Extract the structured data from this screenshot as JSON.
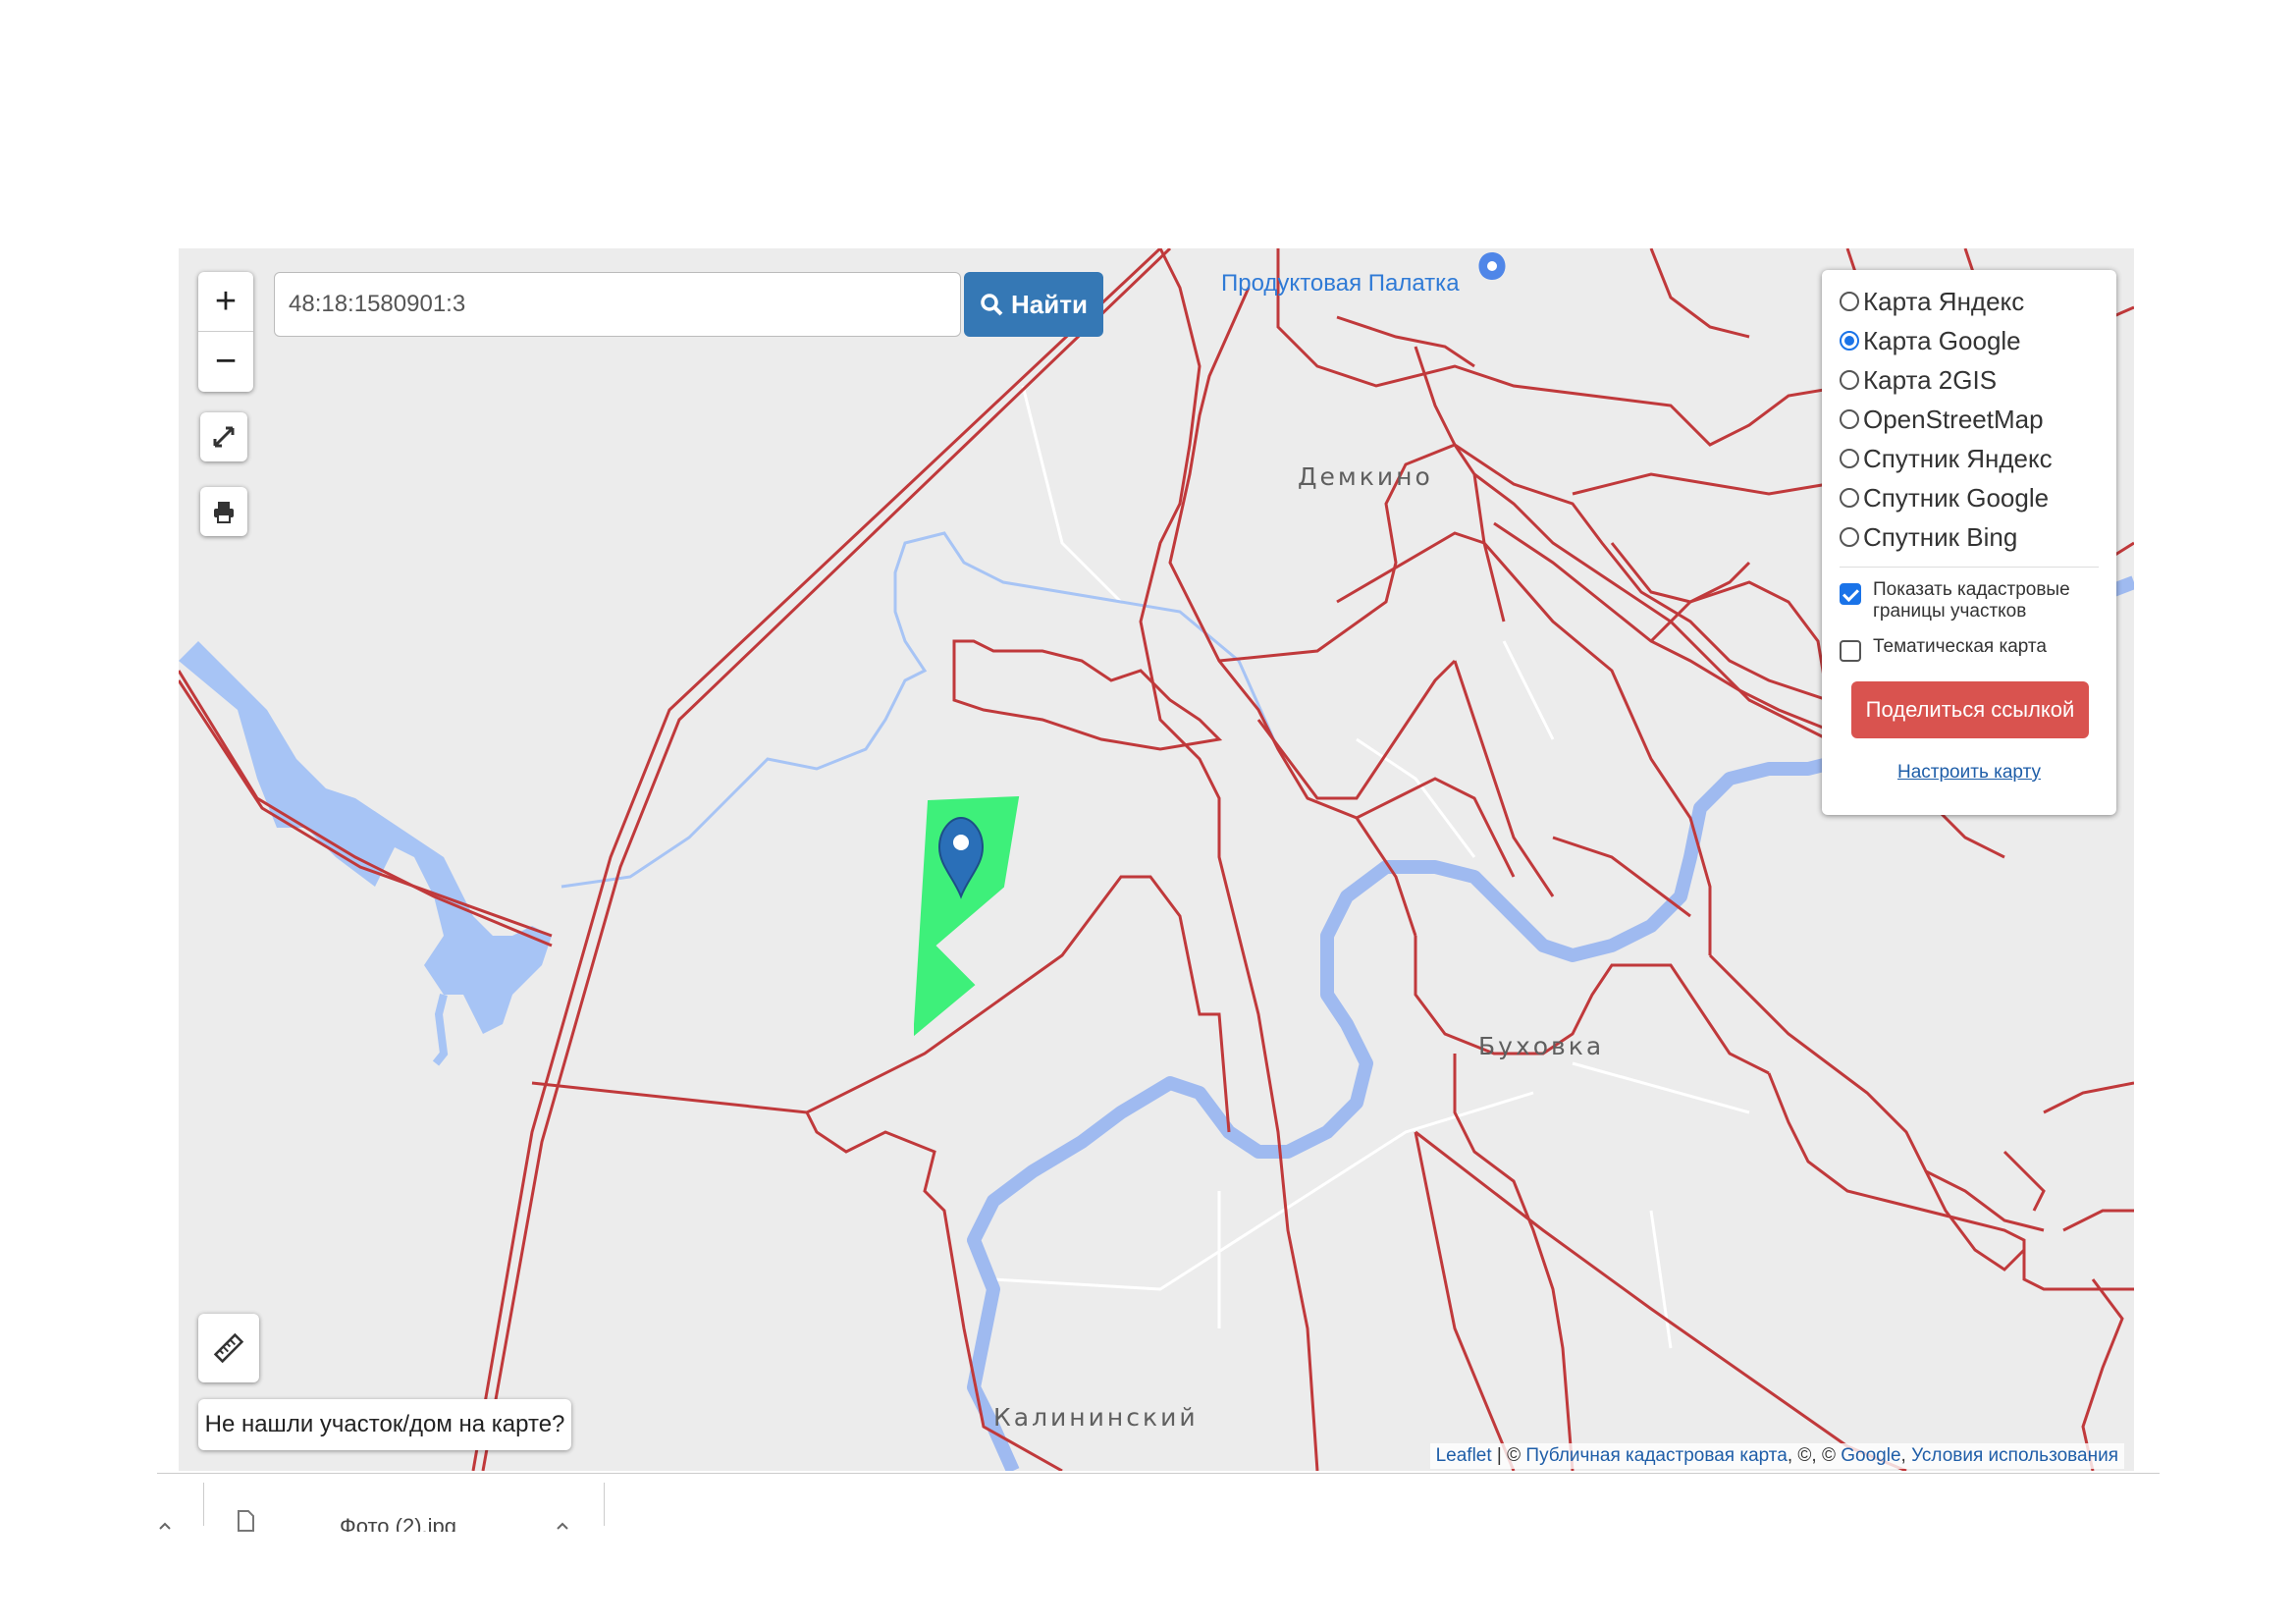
{
  "search": {
    "value": "48:18:1580901:3",
    "button_label": "Найти"
  },
  "zoom": {
    "in_label": "+",
    "out_label": "−"
  },
  "map_labels": {
    "poi": "Продуктовая Палатка",
    "village1": "Демкино",
    "village2": "Буховка",
    "village3": "Калининский"
  },
  "layers": {
    "options": [
      {
        "label": "Карта Яндекс",
        "selected": false
      },
      {
        "label": "Карта Google",
        "selected": true
      },
      {
        "label": "Карта 2GIS",
        "selected": false
      },
      {
        "label": "OpenStreetMap",
        "selected": false
      },
      {
        "label": "Спутник Яндекс",
        "selected": false
      },
      {
        "label": "Спутник Google",
        "selected": false
      },
      {
        "label": "Спутник Bing",
        "selected": false
      }
    ],
    "show_cadastral_label": "Показать кадастровые границы участков",
    "show_cadastral_checked": true,
    "thematic_label": "Тематическая карта",
    "thematic_checked": false,
    "share_label": "Поделиться ссылкой",
    "configure_label": "Настроить карту"
  },
  "not_found_label": "Не нашли участок/дом на карте?",
  "attribution": {
    "leaflet": "Leaflet",
    "sep1": " | © ",
    "cadastral": "Публичная кадастровая карта",
    "sep2": ", ©, © ",
    "google": "Google",
    "sep3": ", ",
    "terms": "Условия использования"
  },
  "download_bar": {
    "file_name": "Фото (2).jpg"
  },
  "colors": {
    "parcel_border": "#c0393b",
    "parcel_highlight": "#3ef07a",
    "water": "#a7c4f5",
    "marker": "#2a6fb8",
    "share": "#d9534f",
    "find": "#3578b5"
  }
}
